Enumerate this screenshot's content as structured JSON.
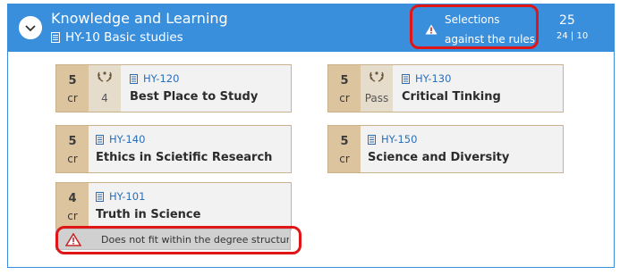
{
  "group": {
    "title": "Knowledge and Learning",
    "subtitle": "HY-10 Basic studies",
    "warning_line1": "Selections",
    "warning_line2": "against the rules",
    "credits_total": "25",
    "credits_split": "24 | 10"
  },
  "courses": [
    {
      "credits": "5",
      "unit": "cr",
      "grade": "4",
      "code": "HY-120",
      "name": "Best Place to Study"
    },
    {
      "credits": "5",
      "unit": "cr",
      "grade": "Pass",
      "code": "HY-130",
      "name": "Critical Tinking"
    },
    {
      "credits": "5",
      "unit": "cr",
      "code": "HY-140",
      "name": "Ethics in Scietific Research"
    },
    {
      "credits": "5",
      "unit": "cr",
      "code": "HY-150",
      "name": "Science and Diversity"
    },
    {
      "credits": "4",
      "unit": "cr",
      "code": "HY-101",
      "name": "Truth in Science"
    }
  ],
  "course_warning": "Does not fit within the degree structure",
  "colors": {
    "header": "#3a8fdc",
    "credit_bg": "#dcc49e",
    "annotation": "#e01515"
  }
}
